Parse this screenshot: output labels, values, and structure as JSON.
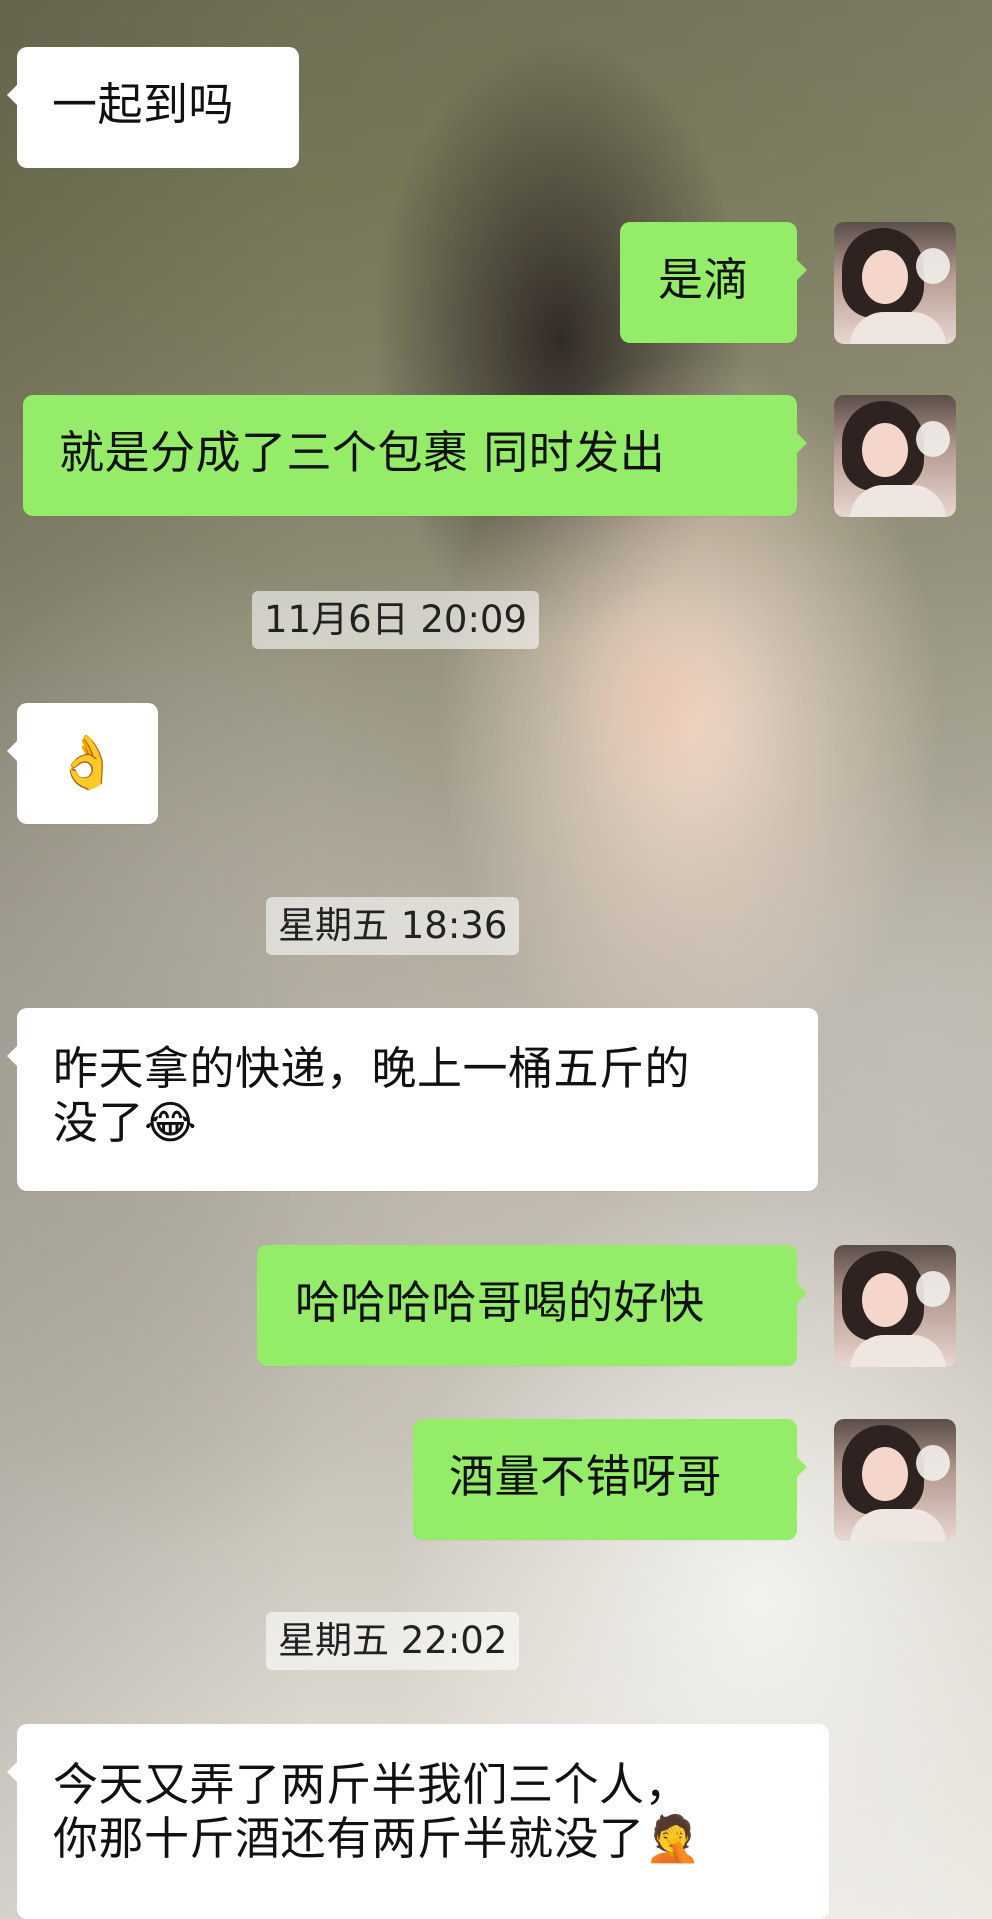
{
  "chat": {
    "messages": [
      {
        "text": "一起到吗"
      },
      {
        "text": "是滴"
      },
      {
        "text": "就是分成了三个包裹  同时发出"
      },
      {
        "text": "👌"
      },
      {
        "text": "昨天拿的快递，晚上一桶五斤的\n没了😂"
      },
      {
        "text": "哈哈哈哈哥喝的好快"
      },
      {
        "text": "酒量不错呀哥"
      },
      {
        "text": "今天又弄了两斤半我们三个人，\n你那十斤酒还有两斤半就没了🤦"
      }
    ],
    "timestamps": [
      {
        "text": "11月6日 20:09"
      },
      {
        "text": "星期五 18:36"
      },
      {
        "text": "星期五 22:02"
      }
    ]
  }
}
